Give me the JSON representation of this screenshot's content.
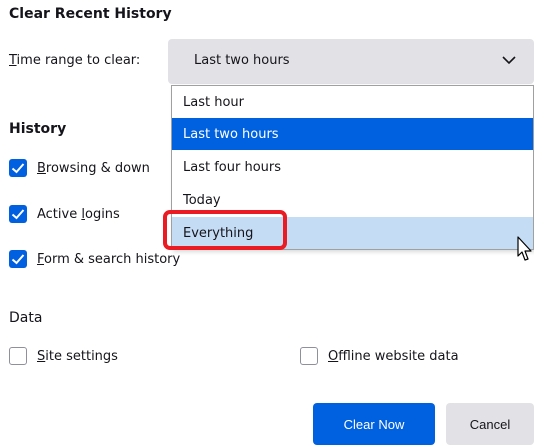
{
  "dialog": {
    "title": "Clear Recent History"
  },
  "time_range": {
    "label_accesskey": "T",
    "label_rest": "ime range to clear:",
    "selected": "Last two hours",
    "options": [
      "Last hour",
      "Last two hours",
      "Last four hours",
      "Today",
      "Everything"
    ]
  },
  "history": {
    "title": "History",
    "items": [
      {
        "accesskey": "B",
        "rest": "rowsing & down",
        "checked": true
      },
      {
        "pre": "Active ",
        "accesskey": "l",
        "rest": "ogins",
        "checked": true
      },
      {
        "accesskey": "F",
        "rest": "orm & search history",
        "checked": true
      }
    ]
  },
  "data": {
    "title": "Data",
    "items": [
      {
        "accesskey": "S",
        "rest": "ite settings",
        "checked": false
      },
      {
        "accesskey": "O",
        "rest": "ffline website data",
        "checked": false
      }
    ]
  },
  "buttons": {
    "clear": "Clear Now",
    "cancel": "Cancel"
  },
  "colors": {
    "accent": "#0061e0",
    "hover_option": "#c5dcf5",
    "highlight": "#ea1b23",
    "select_bg": "#e2e2e6"
  }
}
